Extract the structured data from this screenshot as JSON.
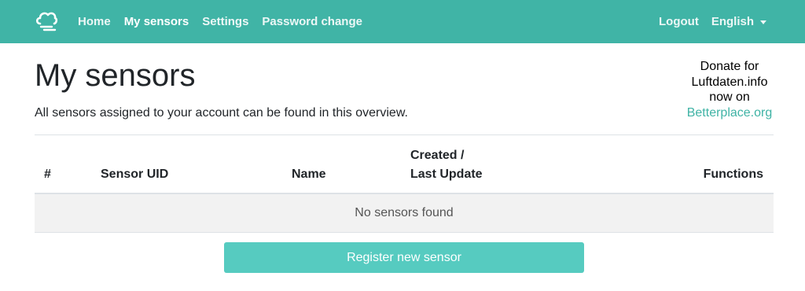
{
  "nav": {
    "items": [
      {
        "label": "Home"
      },
      {
        "label": "My sensors"
      },
      {
        "label": "Settings"
      },
      {
        "label": "Password change"
      }
    ],
    "logout": "Logout",
    "language": "English"
  },
  "page": {
    "title": "My sensors",
    "lead": "All sensors assigned to your account can be found in this overview."
  },
  "donate": {
    "line1": "Donate for",
    "line2": "Luftdaten.info",
    "line3": "now on",
    "link": "Betterplace.org"
  },
  "table": {
    "headers": {
      "index": "#",
      "uid": "Sensor UID",
      "name": "Name",
      "created_line1": "Created /",
      "created_line2": "Last Update",
      "functions": "Functions"
    },
    "empty_message": "No sensors found"
  },
  "register_button": "Register new sensor",
  "colors": {
    "navbar": "#40b4a6",
    "button": "#56cbc0",
    "link": "#3fb3a5"
  },
  "icons": {
    "brand": "cloud-logo-icon",
    "language_caret": "caret-down-icon"
  }
}
